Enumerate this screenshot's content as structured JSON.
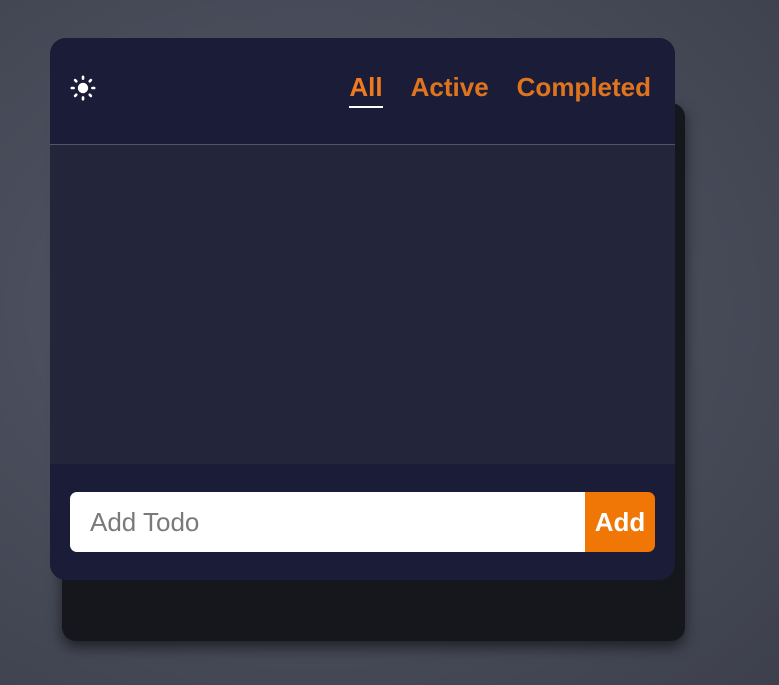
{
  "header": {
    "theme_toggle_icon": "sun-icon",
    "filters": [
      {
        "label": "All",
        "active": true
      },
      {
        "label": "Active",
        "active": false
      },
      {
        "label": "Completed",
        "active": false
      }
    ]
  },
  "todos": [],
  "footer": {
    "input_value": "",
    "input_placeholder": "Add Todo",
    "add_label": "Add"
  },
  "colors": {
    "accent": "#f07605",
    "card_bg": "#1b1d38",
    "list_bg": "#23253b"
  }
}
